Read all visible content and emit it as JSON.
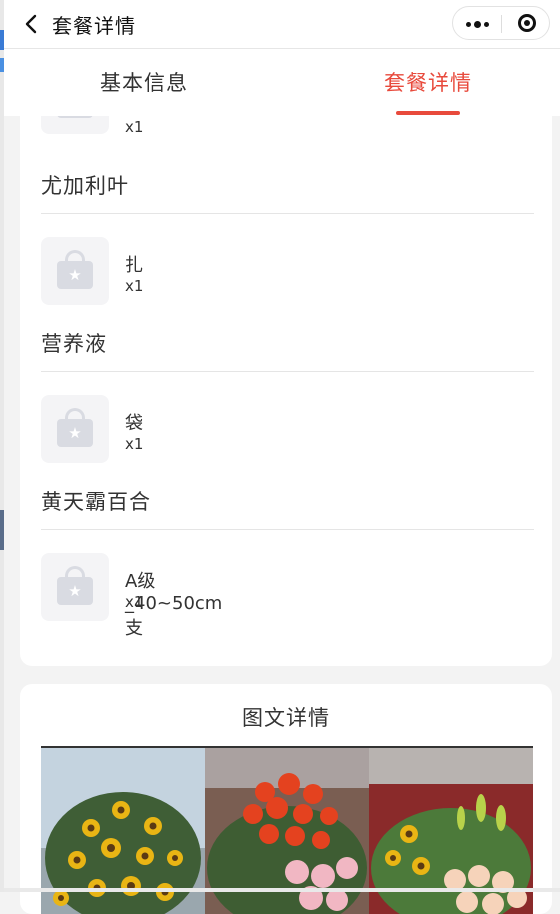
{
  "nav": {
    "title": "套餐详情"
  },
  "tabs": [
    {
      "label": "基本信息",
      "active": false
    },
    {
      "label": "套餐详情",
      "active": true
    }
  ],
  "package_items": {
    "partial_item": {
      "qty": "x1"
    },
    "groups": [
      {
        "name": "尤加利叶",
        "unit": "扎",
        "qty": "x1"
      },
      {
        "name": "营养液",
        "unit": "袋",
        "qty": "x1"
      },
      {
        "name": "黄天霸百合",
        "unit": "A级_40~50cm支",
        "qty": "x1"
      }
    ]
  },
  "detail_section": {
    "title": "图文详情"
  },
  "colors": {
    "accent": "#e84a3c",
    "placeholder_bg": "#f4f4f6",
    "placeholder_icon": "#d9dbe2"
  },
  "icons": [
    "chevron-left-icon",
    "more-dots-icon",
    "mini-program-close-icon",
    "shopping-bag-placeholder-icon"
  ]
}
